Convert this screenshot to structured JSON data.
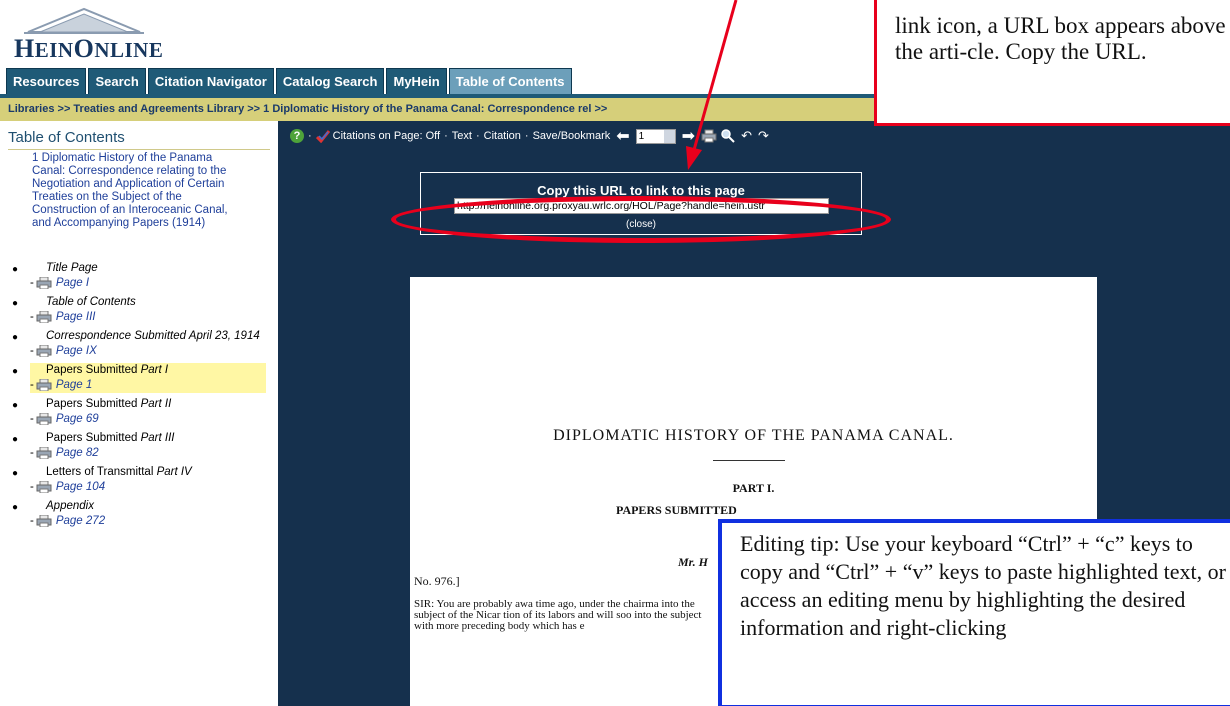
{
  "logo": {
    "prefix_big": "H",
    "prefix_small": "EIN",
    "suffix_big": "O",
    "suffix_small": "NLINE"
  },
  "tabs": [
    {
      "label": "Resources",
      "active": false
    },
    {
      "label": "Search",
      "active": false
    },
    {
      "label": "Citation Navigator",
      "active": false
    },
    {
      "label": "Catalog Search",
      "active": false
    },
    {
      "label": "MyHein",
      "active": false
    },
    {
      "label": "Table of Contents",
      "active": true
    }
  ],
  "breadcrumb": "Libraries >> Treaties and Agreements Library >> 1 Diplomatic History of the Panama Canal: Correspondence rel >>",
  "sidebar": {
    "title": "Table of Contents",
    "book_title": "1 Diplomatic History of the Panama Canal: Correspondence relating to the Negotiation and Application of Certain Treaties on the Subject of the Construction of an Interoceanic Canal, and Accompanying Papers (1914)",
    "entries": [
      {
        "name": "Title Page",
        "italic_part": "",
        "page": "Page I",
        "highlighted": false
      },
      {
        "name": "Table of Contents",
        "italic_part": "",
        "page": "Page III",
        "highlighted": false
      },
      {
        "name": "Correspondence Submitted April 23, 1914",
        "italic_part": "",
        "page": "Page IX",
        "highlighted": false
      },
      {
        "name": "Papers Submitted ",
        "italic_part": "Part I",
        "page": "Page 1",
        "highlighted": true
      },
      {
        "name": "Papers Submitted ",
        "italic_part": "Part II",
        "page": "Page 69",
        "highlighted": false
      },
      {
        "name": "Papers Submitted ",
        "italic_part": "Part III",
        "page": "Page 82",
        "highlighted": false
      },
      {
        "name": "Letters of Transmittal ",
        "italic_part": "Part IV",
        "page": "Page 104",
        "highlighted": false
      },
      {
        "name": "Appendix",
        "italic_part": "",
        "page": "Page 272",
        "highlighted": false
      }
    ]
  },
  "toolbar": {
    "help": "?",
    "citations": "Citations on Page: Off",
    "text": "Text",
    "citation": "Citation",
    "save": "Save/Bookmark",
    "page_value": "1"
  },
  "urlbox": {
    "title": "Copy this URL to link to this page",
    "url": "http://heinonline.org.proxyau.wrlc.org/HOL/Page?handle=hein.ustr",
    "close": "(close)"
  },
  "document": {
    "heading": "DIPLOMATIC HISTORY OF THE PANAMA CANAL.",
    "part": "PART I.",
    "papers": "PAPERS SUBMITTED",
    "mr": "Mr. H",
    "number": "No. 976.]",
    "body": "SIR: You are probably awa time ago, under the chairma into the subject of the Nicar tion of its labors and will soo into the subject with more preceding body which has e"
  },
  "notes": {
    "top": "link icon, a URL box appears above the arti-cle. Copy the URL.",
    "bottom": "Editing tip: Use your keyboard “Ctrl” + “c” keys to copy and “Ctrl” + “v” keys to paste highlighted text, or access an editing menu by highlighting the desired information and right-clicking"
  },
  "colors": {
    "tab_bg": "#1f5a77",
    "tab_active": "#6c9fba",
    "breadcrumb_bg": "#d6cf7a",
    "viewer_bg": "#15304d",
    "highlight": "#fff7a4",
    "annotation_red": "#e8001c",
    "annotation_blue": "#1030e0"
  }
}
